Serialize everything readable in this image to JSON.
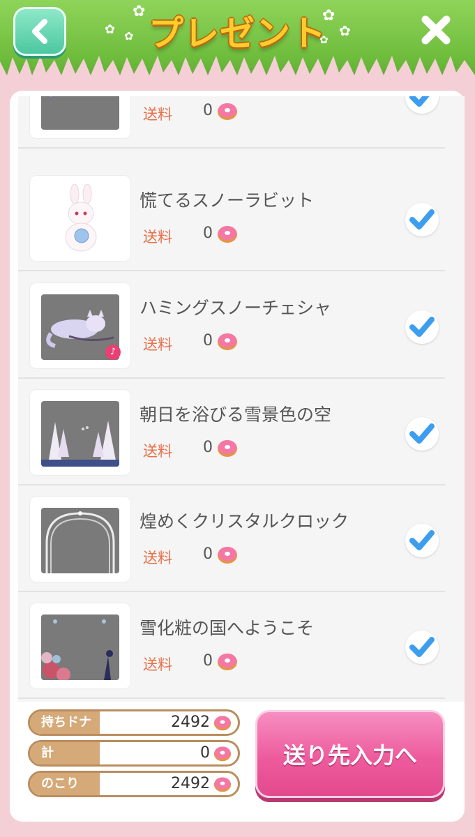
{
  "header": {
    "title": "プレゼント",
    "back_icon": "chevron-left-icon",
    "close_icon": "close-icon"
  },
  "items": [
    {
      "name": "",
      "ship_label": "送料",
      "ship_value": "0"
    },
    {
      "name": "慌てるスノーラビット",
      "ship_label": "送料",
      "ship_value": "0"
    },
    {
      "name": "ハミングスノーチェシャ",
      "ship_label": "送料",
      "ship_value": "0"
    },
    {
      "name": "朝日を浴びる雪景色の空",
      "ship_label": "送料",
      "ship_value": "0"
    },
    {
      "name": "煌めくクリスタルクロック",
      "ship_label": "送料",
      "ship_value": "0"
    },
    {
      "name": "雪化粧の国へようこそ",
      "ship_label": "送料",
      "ship_value": "0"
    }
  ],
  "summary": {
    "owned_label": "持ちドナ",
    "owned_value": "2492",
    "total_label": "計",
    "total_value": "0",
    "remaining_label": "のこり",
    "remaining_value": "2492"
  },
  "send_button": {
    "label": "送り先入力へ"
  },
  "colors": {
    "accent_pink": "#ee5b9d",
    "check_blue": "#3d9ef0",
    "ship_orange": "#e8704a"
  }
}
